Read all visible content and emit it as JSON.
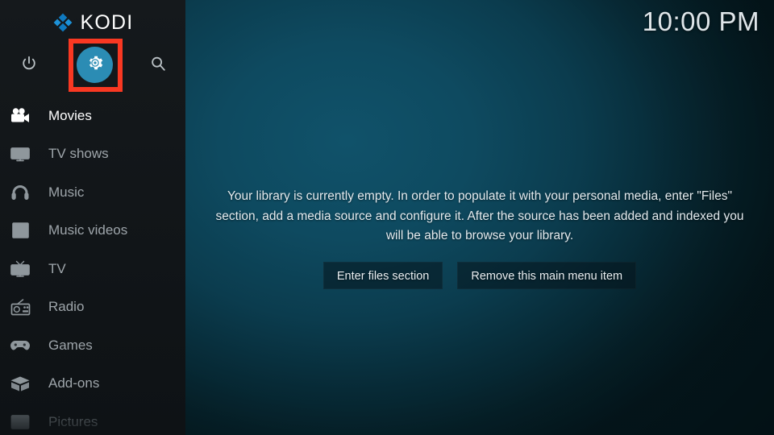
{
  "app": {
    "name": "KODI",
    "logo_icon": "kodi-logo-icon"
  },
  "clock": {
    "time": "10:00 PM"
  },
  "sidebar": {
    "top_actions": [
      {
        "name": "power-icon",
        "label": "Power"
      },
      {
        "name": "settings-gear-icon",
        "label": "Settings",
        "highlighted": true,
        "highlight_color": "#f93822",
        "circle_color": "#2b8cb4"
      },
      {
        "name": "search-icon",
        "label": "Search"
      }
    ],
    "items": [
      {
        "label": "Movies",
        "icon": "movie-camera-icon",
        "state": "active"
      },
      {
        "label": "TV shows",
        "icon": "tv-monitor-icon",
        "state": "normal"
      },
      {
        "label": "Music",
        "icon": "headphones-icon",
        "state": "normal"
      },
      {
        "label": "Music videos",
        "icon": "music-video-icon",
        "state": "normal"
      },
      {
        "label": "TV",
        "icon": "tv-set-icon",
        "state": "normal"
      },
      {
        "label": "Radio",
        "icon": "radio-icon",
        "state": "normal"
      },
      {
        "label": "Games",
        "icon": "gamepad-icon",
        "state": "normal"
      },
      {
        "label": "Add-ons",
        "icon": "open-box-icon",
        "state": "normal"
      },
      {
        "label": "Pictures",
        "icon": "picture-frame-icon",
        "state": "dim"
      }
    ]
  },
  "main": {
    "empty_message": "Your library is currently empty. In order to populate it with your personal media, enter \"Files\" section, add a media source and configure it. After the source has been added and indexed you will be able to browse your library.",
    "buttons": [
      {
        "label": "Enter files section",
        "name": "enter-files-section-button"
      },
      {
        "label": "Remove this main menu item",
        "name": "remove-main-menu-item-button"
      }
    ]
  },
  "colors": {
    "accent_blue": "#2b8cb4",
    "highlight_red": "#f93822",
    "background_teal": "#0e4a60",
    "sidebar_dark": "#121619"
  }
}
